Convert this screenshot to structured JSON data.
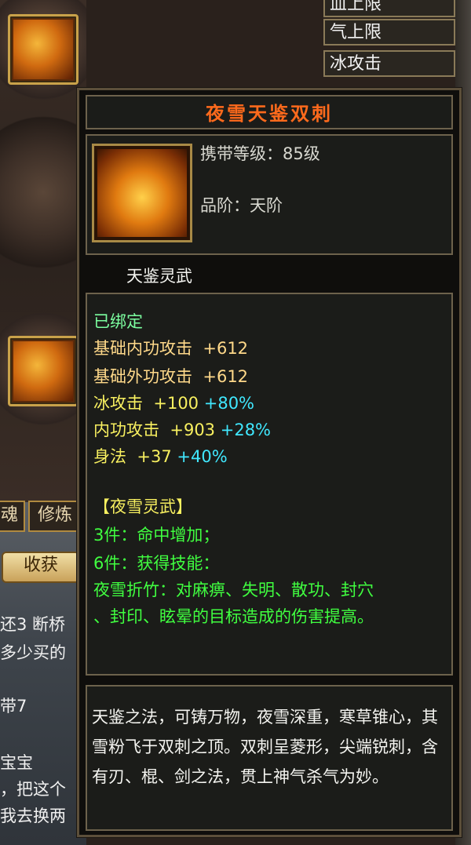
{
  "background": {
    "stat_rows": [
      "血上限",
      "气上限",
      "冰攻击"
    ],
    "tabs": [
      "魂",
      "修炼"
    ],
    "harvest_button": "收获",
    "chat_lines": [
      "还3 断桥",
      "多少买的",
      "带7",
      "宝宝",
      "，把这个",
      "我去换两"
    ]
  },
  "tooltip": {
    "title": "夜雪天鉴双刺",
    "carry_level": "携带等级：85级",
    "grade": "品阶：天阶",
    "series": "天鉴灵武",
    "bound": "已绑定",
    "stats": [
      {
        "label": "基础内功攻击",
        "base": "+612",
        "bonus": ""
      },
      {
        "label": "基础外功攻击",
        "base": "+612",
        "bonus": ""
      },
      {
        "label": "冰攻击",
        "base": "+100",
        "bonus": "+80%"
      },
      {
        "label": "内功攻击",
        "base": "+903",
        "bonus": "+28%"
      },
      {
        "label": "身法",
        "base": "+37",
        "bonus": "+40%"
      }
    ],
    "set_name": "【夜雪灵武】",
    "set_3": "3件：命中增加；",
    "set_6": "6件：获得技能：",
    "skill_line1": "夜雪折竹：对麻痹、失明、散功、封穴",
    "skill_line2": "、封印、眩晕的目标造成的伤害提高。",
    "description": "天鉴之法，可铸万物，夜雪深重，寒草锥心，其雪粉飞于双刺之顶。双刺呈菱形，尖端锐刺，含有刃、棍、剑之法，贯上神气杀气为妙。"
  }
}
